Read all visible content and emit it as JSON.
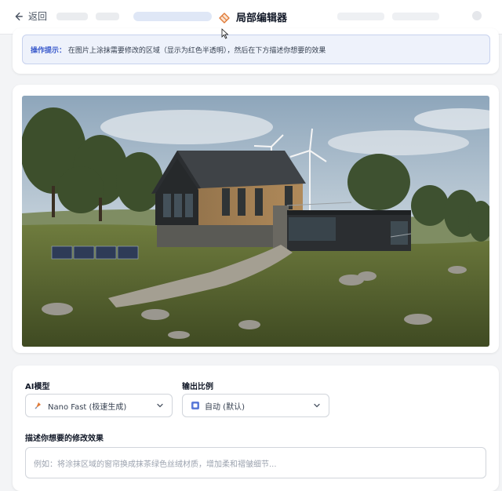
{
  "header": {
    "back_label": "返回",
    "title": "局部编辑器"
  },
  "tip": {
    "label": "操作提示：",
    "text": "在图片上涂抹需要修改的区域（显示为红色半透明），然后在下方描述你想要的效果"
  },
  "form": {
    "model_label": "AI模型",
    "model_value": "Nano Fast (极速生成)",
    "ratio_label": "输出比例",
    "ratio_value": "自动 (默认)",
    "describe_label": "描述你想要的修改效果",
    "describe_placeholder": "例如：将涂抹区域的窗帘换成抹茶绿色丝绒材质，增加柔和褶皱细节..."
  },
  "colors": {
    "accent": "#3b5bcc",
    "tip_bg": "#eef2fb",
    "title_icon": "#e07b39"
  },
  "icons": {
    "back": "arrow-left-icon",
    "title": "eraser-icon",
    "model": "rocket-icon",
    "ratio": "ratio-icon",
    "dropdown": "chevron-down-icon"
  }
}
